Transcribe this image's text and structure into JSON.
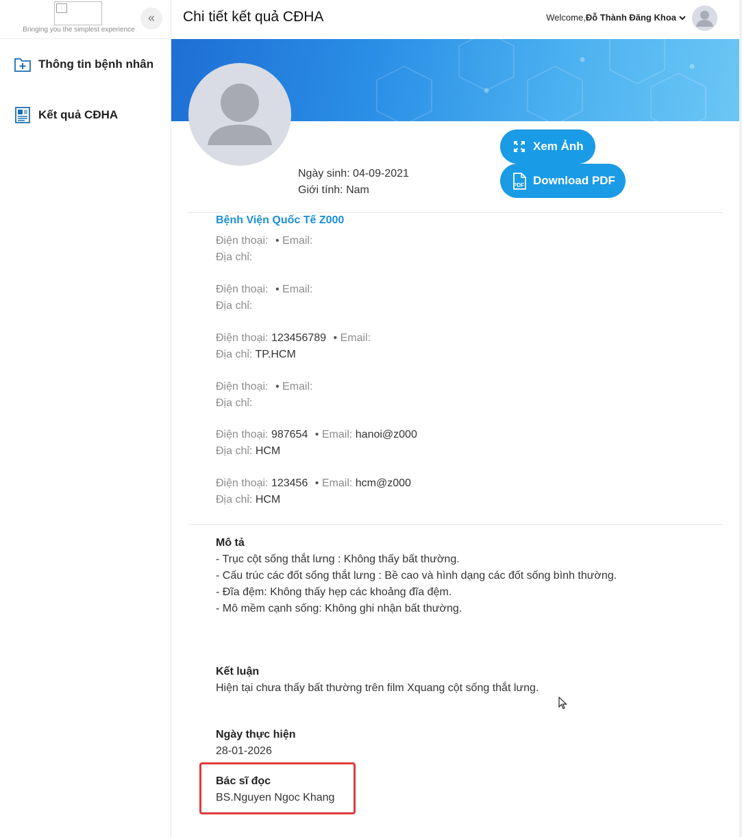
{
  "sidebar": {
    "tagline": "Bringing you the simplest experience",
    "items": [
      {
        "label": "Thông tin bệnh nhân",
        "icon": "folder-plus-icon"
      },
      {
        "label": "Kết quả CĐHA",
        "icon": "report-icon"
      }
    ]
  },
  "header": {
    "title": "Chi tiết kết quả CĐHA",
    "welcome_prefix": "Welcome,",
    "user_name": "Đỗ Thành Đăng Khoa"
  },
  "patient": {
    "dob_label": "Ngày sinh:",
    "dob": "04-09-2021",
    "gender_label": "Giới tính:",
    "gender": "Nam"
  },
  "actions": {
    "view_label": "Xem Ảnh",
    "pdf_label": "Download PDF"
  },
  "hospital": {
    "name": "Bệnh Viện Quốc Tế Z000",
    "phone_label": "Điện thoại:",
    "email_label": "Email:",
    "address_label": "Địa chỉ:",
    "contacts": [
      {
        "phone": "",
        "email": "",
        "address": ""
      },
      {
        "phone": "",
        "email": "",
        "address": ""
      },
      {
        "phone": "123456789",
        "email": "",
        "address": "TP.HCM"
      },
      {
        "phone": "",
        "email": "",
        "address": ""
      },
      {
        "phone": "987654",
        "email": "hanoi@z000",
        "address": "HCM"
      },
      {
        "phone": "123456",
        "email": "hcm@z000",
        "address": "HCM"
      }
    ]
  },
  "description": {
    "title": "Mô tả",
    "lines": [
      "- Trục cột sống thắt lưng : Không thấy bất thường.",
      "- Cấu trúc các đốt sống thắt lưng : Bề cao và hình dạng các đốt sống bình thường.",
      "- Đĩa đệm: Không thấy hẹp các khoảng đĩa đệm.",
      "- Mô mềm cạnh sống: Không ghi nhận bất thường."
    ]
  },
  "conclusion": {
    "title": "Kết luận",
    "text": "Hiện tại chưa thấy bất thường trên film Xquang cột sống thắt lưng."
  },
  "performed": {
    "title": "Ngày thực hiện",
    "date": "28-01-2026"
  },
  "doctor": {
    "title": "Bác sĩ đọc",
    "name": "BS.Nguyen Ngoc Khang"
  },
  "colors": {
    "accent": "#1a9be6",
    "link": "#1a8fd8",
    "highlight": "#e0393b"
  }
}
